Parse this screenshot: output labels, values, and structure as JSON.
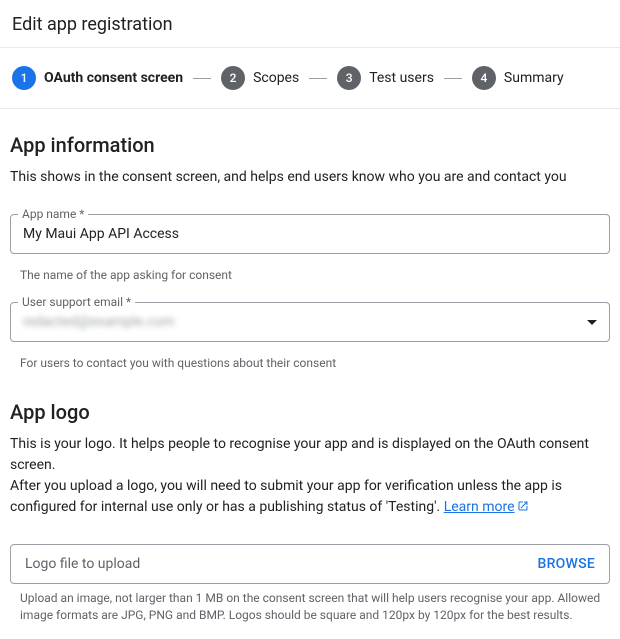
{
  "header": {
    "title": "Edit app registration"
  },
  "stepper": [
    {
      "num": "1",
      "label": "OAuth consent screen",
      "active": true
    },
    {
      "num": "2",
      "label": "Scopes",
      "active": false
    },
    {
      "num": "3",
      "label": "Test users",
      "active": false
    },
    {
      "num": "4",
      "label": "Summary",
      "active": false
    }
  ],
  "appInfo": {
    "title": "App information",
    "desc": "This shows in the consent screen, and helps end users know who you are and contact you",
    "appName": {
      "label": "App name *",
      "value": "My Maui App API Access",
      "helper": "The name of the app asking for consent"
    },
    "supportEmail": {
      "label": "User support email *",
      "value": "redacted@example.com",
      "helper": "For users to contact you with questions about their consent"
    }
  },
  "appLogo": {
    "title": "App logo",
    "desc1": "This is your logo. It helps people to recognise your app and is displayed on the OAuth consent screen.",
    "desc2": "After you upload a logo, you will need to submit your app for verification unless the app is configured for internal use only or has a publishing status of 'Testing'. ",
    "learnMore": "Learn more",
    "uploadPlaceholder": "Logo file to upload",
    "browse": "BROWSE",
    "helper": "Upload an image, not larger than 1 MB on the consent screen that will help users recognise your app. Allowed image formats are JPG, PNG and BMP. Logos should be square and 120px by 120px for the best results."
  }
}
